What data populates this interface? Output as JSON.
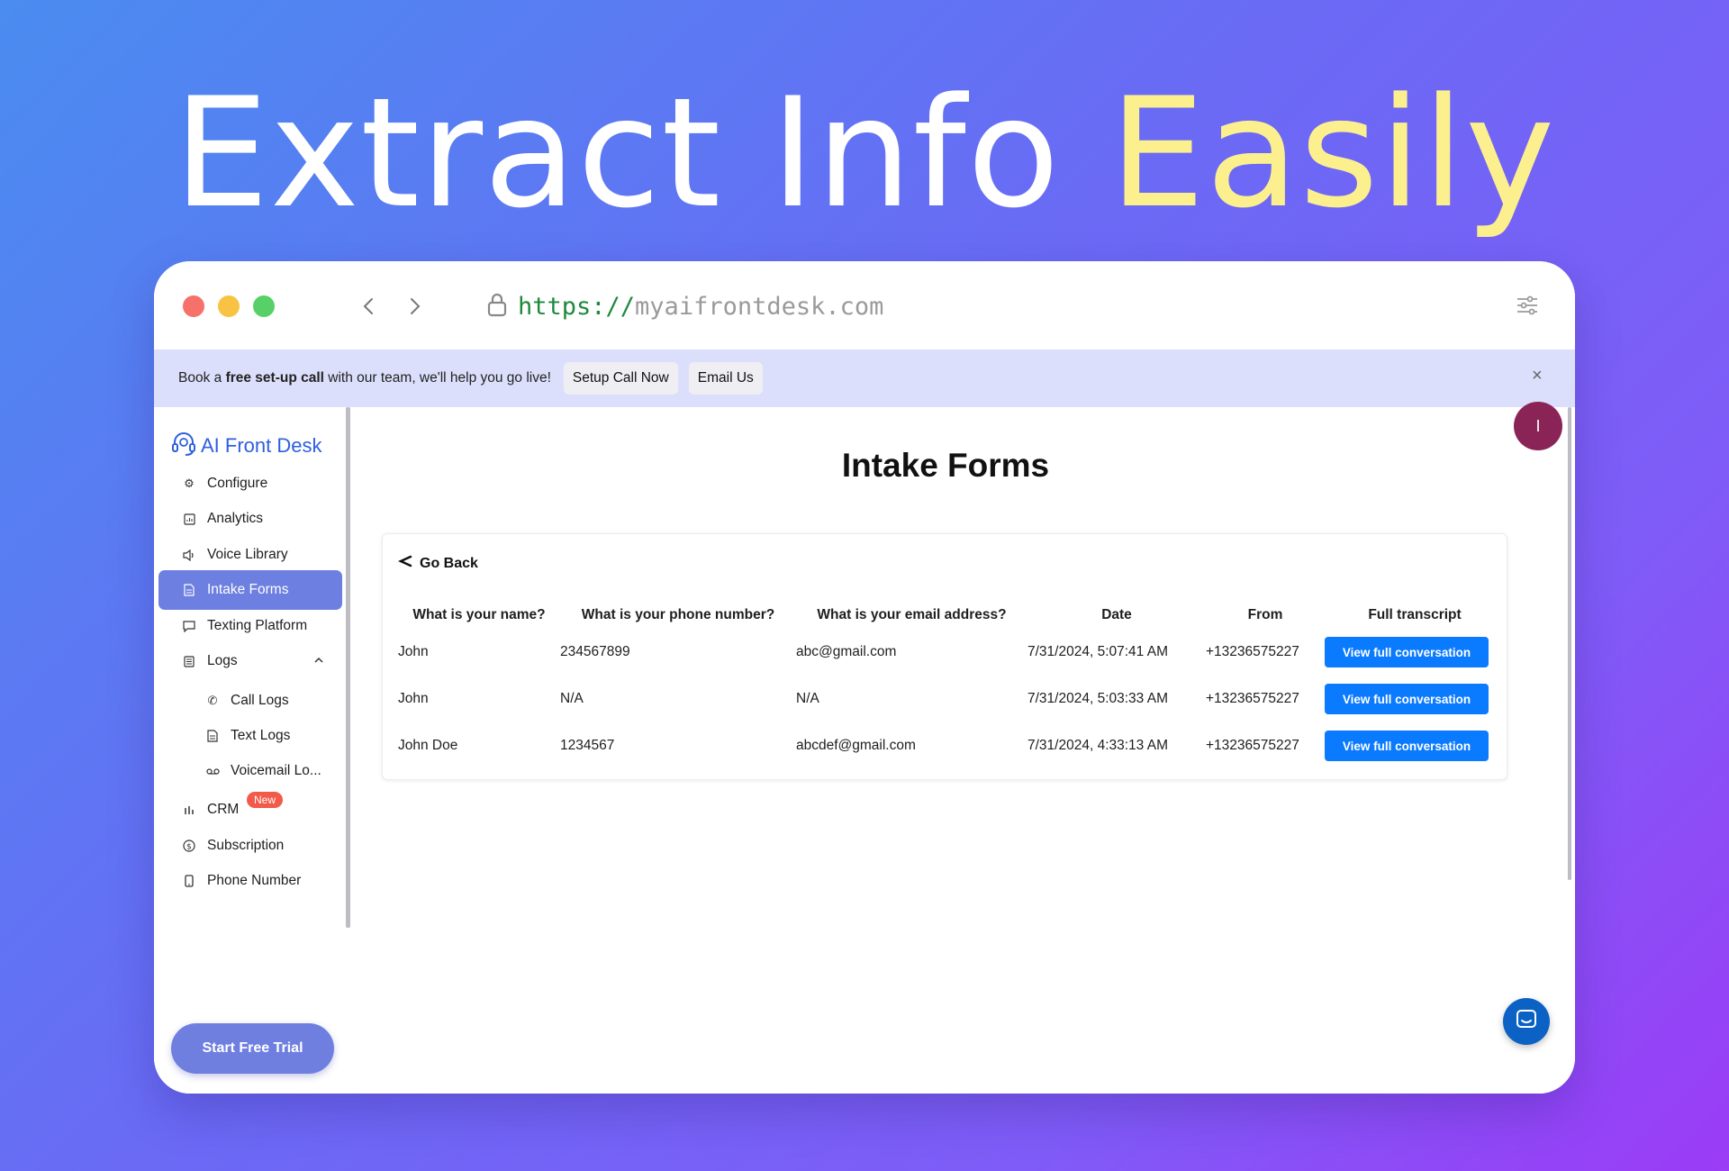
{
  "hero": {
    "title_main": "Extract Info ",
    "title_accent": "Easily"
  },
  "browser": {
    "url_protocol": "https://",
    "url_host": "myaifrontdesk.com"
  },
  "banner": {
    "text_prefix": "Book a ",
    "text_bold": "free set-up call",
    "text_suffix": " with our team, we'll help you go live!",
    "setup_button": "Setup Call Now",
    "email_button": "Email Us",
    "close_symbol": "×"
  },
  "sidebar": {
    "logo": "AI Front Desk",
    "items": [
      {
        "label": "Configure",
        "icon": "gear-icon"
      },
      {
        "label": "Analytics",
        "icon": "chart-icon"
      },
      {
        "label": "Voice Library",
        "icon": "speaker-icon"
      },
      {
        "label": "Intake Forms",
        "icon": "document-icon"
      },
      {
        "label": "Texting Platform",
        "icon": "message-icon"
      },
      {
        "label": "Logs",
        "icon": "list-icon"
      },
      {
        "label": "Call Logs",
        "icon": "phone-icon"
      },
      {
        "label": "Text Logs",
        "icon": "document-icon"
      },
      {
        "label": "Voicemail Lo...",
        "icon": "voicemail-icon"
      },
      {
        "label": "CRM",
        "icon": "bars-icon",
        "badge": "New"
      },
      {
        "label": "Subscription",
        "icon": "dollar-icon"
      },
      {
        "label": "Phone Number",
        "icon": "mobile-icon"
      }
    ],
    "cta": "Start Free Trial"
  },
  "user": {
    "avatar_initial": "I"
  },
  "main": {
    "title": "Intake Forms",
    "go_back": "Go Back",
    "columns": [
      "What is your name?",
      "What is your phone number?",
      "What is your email address?",
      "Date",
      "From",
      "Full transcript"
    ],
    "rows": [
      {
        "name": "John",
        "phone": "234567899",
        "email": "abc@gmail.com",
        "date": "7/31/2024, 5:07:41 AM",
        "from": "+13236575227",
        "action": "View full conversation"
      },
      {
        "name": "John",
        "phone": "N/A",
        "email": "N/A",
        "date": "7/31/2024, 5:03:33 AM",
        "from": "+13236575227",
        "action": "View full conversation"
      },
      {
        "name": "John Doe",
        "phone": "1234567",
        "email": "abcdef@gmail.com",
        "date": "7/31/2024, 4:33:13 AM",
        "from": "+13236575227",
        "action": "View full conversation"
      }
    ]
  },
  "colors": {
    "accent": "#0a7aff",
    "active_nav": "#6d7fe0",
    "brand": "#2f5fe0",
    "hero_accent": "#fcf08e"
  }
}
